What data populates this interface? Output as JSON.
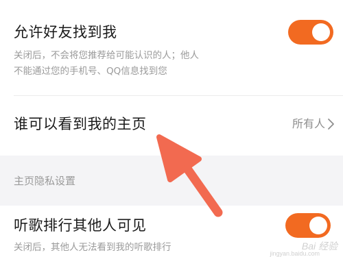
{
  "settings": {
    "allow_find": {
      "title": "允许好友找到我",
      "desc_line1": "关闭后，不会将您推荐给可能认识的人；他人",
      "desc_line2": "不能通过您的手机号、QQ信息找到您",
      "toggle_on": true
    },
    "homepage_visibility": {
      "title": "谁可以看到我的主页",
      "value": "所有人"
    },
    "section_label": "主页隐私设置",
    "ranking_visible": {
      "title": "听歌排行其他人可见",
      "desc_line1": "关闭后，其他人无法看到我的听歌排行",
      "toggle_on": true
    }
  },
  "overlay": {
    "watermark": "Bai 经验",
    "watermark_sub": "jingyan.baidu.com"
  },
  "colors": {
    "accent": "#f26a21",
    "arrow": "#f26a50"
  }
}
